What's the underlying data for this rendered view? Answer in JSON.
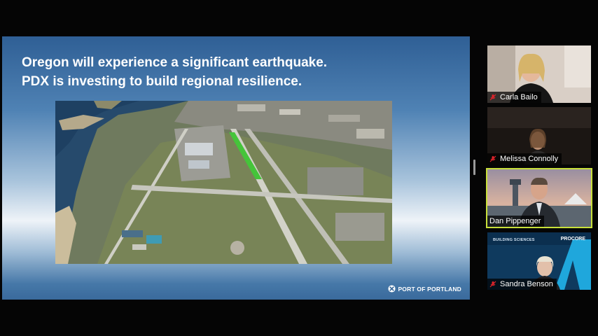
{
  "slide": {
    "title_line1": "Oregon will experience a significant earthquake.",
    "title_line2": "PDX is investing to build regional resilience.",
    "logo_text": "PORT OF PORTLAND"
  },
  "participants": [
    {
      "name": "Carla Bailo",
      "muted": true,
      "active": false
    },
    {
      "name": "Melissa Connolly",
      "muted": true,
      "active": false
    },
    {
      "name": "Dan Pippenger",
      "muted": false,
      "active": true
    },
    {
      "name": "Sandra Benson",
      "muted": true,
      "active": false
    }
  ],
  "sponsor_badge": {
    "left_text": "BUILDING SCIENCES",
    "right_text": "PROCORE"
  },
  "colors": {
    "active_speaker_border": "#c8e03a",
    "mic_muted": "#e0242b",
    "slide_title": "#ffffff"
  }
}
